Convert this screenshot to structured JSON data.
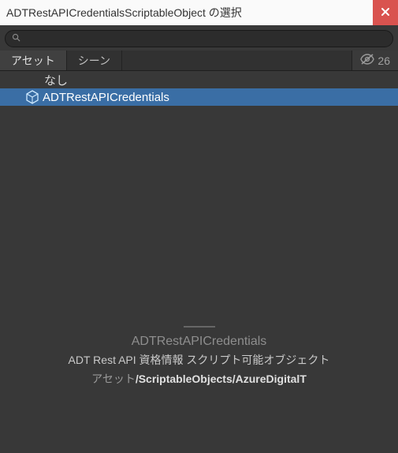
{
  "header": {
    "title": "ADTRestAPICredentialsScriptableObject の選択"
  },
  "search": {
    "value": "",
    "placeholder": ""
  },
  "tabs": {
    "assets": "アセット",
    "scene": "シーン"
  },
  "hidden_count": "26",
  "list": {
    "none_label": "なし",
    "items": [
      {
        "label": "ADTRestAPICredentials",
        "selected": true
      }
    ]
  },
  "details": {
    "name": "ADTRestAPICredentials",
    "description": "ADT Rest API 資格情報 スクリプト可能オブジェクト",
    "path_prefix": "アセット",
    "path_value": "/ScriptableObjects/AzureDigitalT"
  }
}
